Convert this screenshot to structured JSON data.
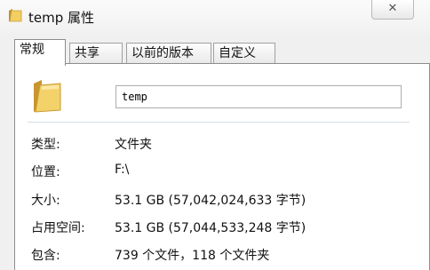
{
  "window": {
    "title": "temp 属性",
    "close_symbol": "✕"
  },
  "tabs": [
    {
      "label": "常规",
      "active": true
    },
    {
      "label": "共享",
      "active": false
    },
    {
      "label": "以前的版本",
      "active": false
    },
    {
      "label": "自定义",
      "active": false
    }
  ],
  "general": {
    "folder_name": "temp",
    "properties": [
      {
        "label": "类型:",
        "value": "文件夹"
      },
      {
        "label": "位置:",
        "value": "F:\\"
      },
      {
        "label": "大小:",
        "value": "53.1 GB (57,042,024,633 字节)"
      },
      {
        "label": "占用空间:",
        "value": "53.1 GB (57,044,533,248 字节)"
      },
      {
        "label": "包含:",
        "value": "739 个文件，118 个文件夹"
      }
    ]
  },
  "colors": {
    "folder_yellow": "#f3d26a",
    "folder_dark": "#d8a93a"
  },
  "icons": [
    "folder-icon",
    "close-icon"
  ]
}
